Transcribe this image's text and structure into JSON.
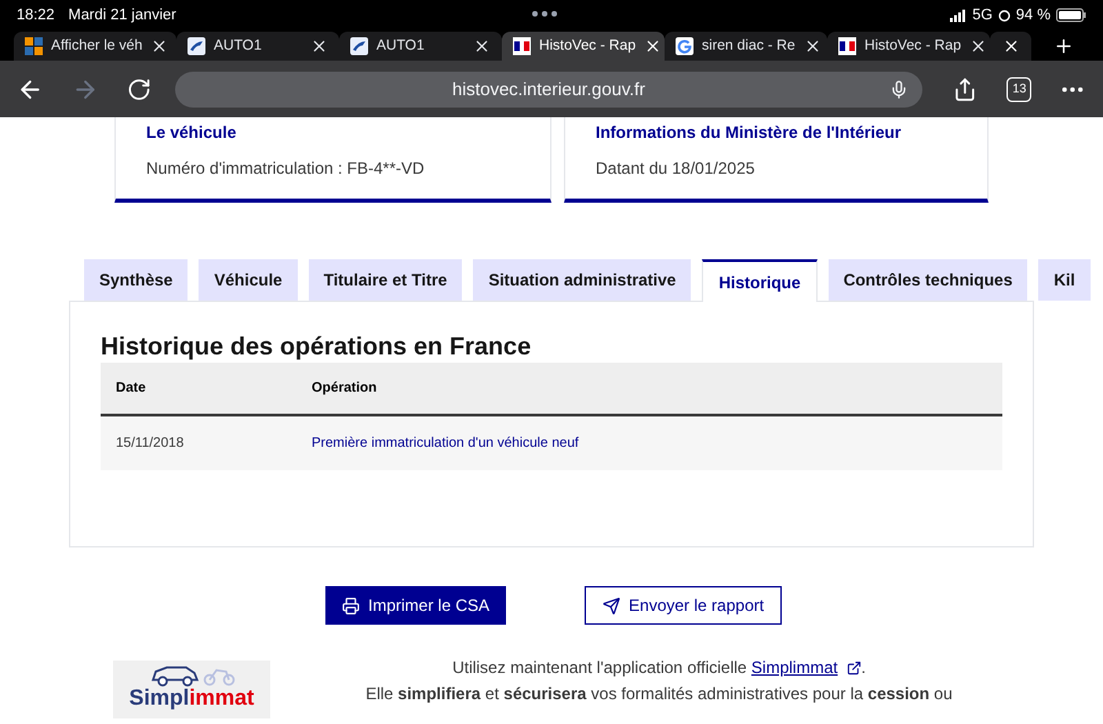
{
  "status_bar": {
    "time": "18:22",
    "date": "Mardi 21 janvier",
    "network": "5G",
    "battery": "94 %"
  },
  "browser_tabs": [
    {
      "title": "Afficher le véh",
      "kind": "squares",
      "selected": false
    },
    {
      "title": "AUTO1",
      "kind": "auto",
      "selected": false
    },
    {
      "title": "AUTO1",
      "kind": "auto",
      "selected": false
    },
    {
      "title": "HistoVec - Rap",
      "kind": "flag",
      "selected": true
    },
    {
      "title": "siren diac - Re",
      "kind": "google",
      "selected": false
    },
    {
      "title": "HistoVec - Rap",
      "kind": "flag",
      "selected": false
    }
  ],
  "tab_count": "13",
  "address_bar": {
    "url": "histovec.interieur.gouv.fr"
  },
  "cards": [
    {
      "title": "Le véhicule",
      "text": "Numéro d'immatriculation : FB-4**-VD"
    },
    {
      "title": "Informations du Ministère de l'Intérieur",
      "text": "Datant du 18/01/2025"
    }
  ],
  "tabs": [
    {
      "label": "Synthèse",
      "selected": false
    },
    {
      "label": "Véhicule",
      "selected": false
    },
    {
      "label": "Titulaire et Titre",
      "selected": false
    },
    {
      "label": "Situation administrative",
      "selected": false
    },
    {
      "label": "Historique",
      "selected": true
    },
    {
      "label": "Contrôles techniques",
      "selected": false
    },
    {
      "label": "Kil",
      "selected": false
    }
  ],
  "section": {
    "title": "Historique des opérations en France",
    "table": {
      "columns": [
        "Date",
        "Opération"
      ],
      "rows": [
        [
          "15/11/2018",
          "Première immatriculation d'un véhicule neuf"
        ]
      ]
    }
  },
  "buttons": [
    {
      "label": "Imprimer le CSA",
      "kind": "primary"
    },
    {
      "label": "Envoyer le rapport",
      "kind": "secondary"
    }
  ],
  "promo": {
    "logo_parts": [
      "Simpl",
      "immat"
    ],
    "line_1": "Utilisez maintenant l'application officielle",
    "link": "Simplimmat",
    "line_1_end": ".",
    "line_2": "Elle **simplifiera** et **sécurisera** vos formalités administratives pour la **cession** ou"
  }
}
